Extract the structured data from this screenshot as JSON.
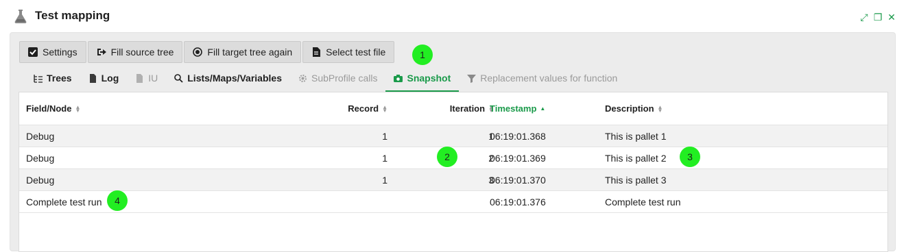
{
  "window": {
    "title": "Test mapping"
  },
  "toolbar": {
    "buttons": [
      {
        "label": "Settings",
        "icon": "checkbox-icon"
      },
      {
        "label": "Fill source tree",
        "icon": "sign-in-icon"
      },
      {
        "label": "Fill target tree again",
        "icon": "radio-dot-icon"
      },
      {
        "label": "Select test file",
        "icon": "file-icon"
      }
    ]
  },
  "tabs": [
    {
      "label": "Trees",
      "icon": "tree-icon",
      "state": "normal"
    },
    {
      "label": "Log",
      "icon": "document-icon",
      "state": "normal"
    },
    {
      "label": "IU",
      "icon": "document-icon",
      "state": "disabled"
    },
    {
      "label": "Lists/Maps/Variables",
      "icon": "search-icon",
      "state": "normal"
    },
    {
      "label": "SubProfile calls",
      "icon": "gear-icon",
      "state": "disabled"
    },
    {
      "label": "Snapshot",
      "icon": "camera-icon",
      "state": "active"
    },
    {
      "label": "Replacement values for function",
      "icon": "filter-icon",
      "state": "disabled"
    }
  ],
  "table": {
    "columns": {
      "field": "Field/Node",
      "record": "Record",
      "iteration": "Iteration",
      "timestamp": "Timestamp",
      "description": "Description"
    },
    "rows": [
      {
        "field": "Debug",
        "record": "1",
        "iteration": "1",
        "timestamp": "06:19:01.368",
        "description": "This is pallet 1"
      },
      {
        "field": "Debug",
        "record": "1",
        "iteration": "2",
        "timestamp": "06:19:01.369",
        "description": "This is pallet 2"
      },
      {
        "field": "Debug",
        "record": "1",
        "iteration": "3",
        "timestamp": "06:19:01.370",
        "description": "This is pallet 3"
      },
      {
        "field": "Complete test run",
        "record": "",
        "iteration": "",
        "timestamp": "06:19:01.376",
        "description": "Complete test run"
      }
    ]
  },
  "markers": [
    "1",
    "2",
    "3",
    "4"
  ],
  "colors": {
    "accent": "#1a9a4a",
    "marker": "#22ee22"
  }
}
